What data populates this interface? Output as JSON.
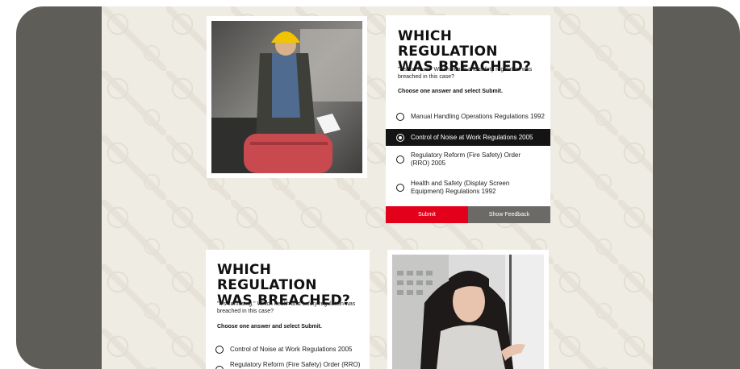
{
  "question1": {
    "title": "WHICH REGULATION\nWAS BREACHED?",
    "text": "\"It's too loud.\" Which health and safety regulation was breached in this case?",
    "instruction": "Choose one answer and select Submit.",
    "options": [
      {
        "label": "Manual Handling Operations Regulations 1992",
        "selected": false
      },
      {
        "label": "Control of Noise at Work Regulations 2005",
        "selected": true
      },
      {
        "label": "Regulatory Reform (Fire Safety) Order (RRO) 2005",
        "selected": false
      },
      {
        "label": "Health and Safety (Display Screen Equipment) Regulations 1992",
        "selected": false
      }
    ],
    "submit_label": "Submit",
    "feedback_label": "Show Feedback"
  },
  "question2": {
    "title": "WHICH REGULATION\nWAS BREACHED?",
    "text": "\"It's confusing.\" Which health and safety regulation was breached in this case?",
    "instruction": "Choose one answer and select Submit.",
    "options": [
      {
        "label": "Control of Noise at Work Regulations 2005",
        "selected": false
      },
      {
        "label": "Regulatory Reform (Fire Safety) Order (RRO)",
        "selected": false
      }
    ]
  },
  "colors": {
    "frame": "#5e5d57",
    "content_bg": "#efece4",
    "submit": "#e3001b",
    "feedback": "#6b6a66",
    "selected_option": "#141414"
  }
}
